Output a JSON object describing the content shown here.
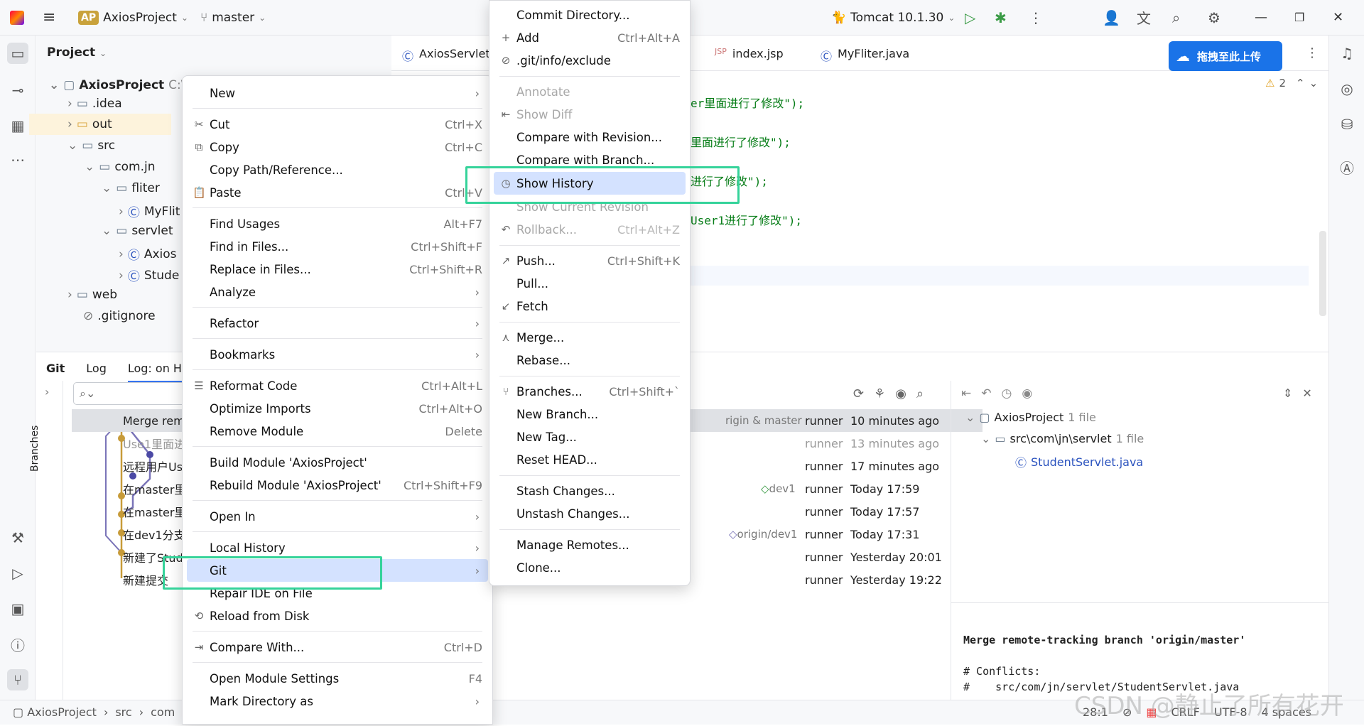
{
  "topbar": {
    "project_badge": "AP",
    "project_name": "AxiosProject",
    "branch": "master",
    "run_config": "Tomcat 10.1.30",
    "upload_button": "拖拽至此上传"
  },
  "project_panel": {
    "title": "Project",
    "tree": [
      {
        "label": "AxiosProject",
        "suffix": "C:\\"
      },
      {
        "label": ".idea"
      },
      {
        "label": "out"
      },
      {
        "label": "src"
      },
      {
        "label": "com.jn"
      },
      {
        "label": "fliter"
      },
      {
        "label": "MyFlit"
      },
      {
        "label": "servlet"
      },
      {
        "label": "Axios"
      },
      {
        "label": "Stude"
      },
      {
        "label": "web"
      },
      {
        "label": ".gitignore"
      }
    ]
  },
  "editor": {
    "tabs": [
      "AxiosServlet",
      "index.jsp",
      "MyFliter.java"
    ],
    "warnings": "2",
    "code_lines": [
      "er里面进行了修改\");",
      "里面进行了修改\");",
      "进行了修改\");",
      "User1进行了修改\");"
    ]
  },
  "git_panel": {
    "tabs": [
      "Git",
      "Log",
      "Log: on H"
    ],
    "branches_label": "Branches",
    "commits": [
      {
        "msg": "Merge remo",
        "tag": "rigin & master",
        "author": "runner",
        "time": "10 minutes ago"
      },
      {
        "msg": "Use1里面进",
        "tag": "",
        "author": "runner",
        "time": "13 minutes ago"
      },
      {
        "msg": "远程用户Us",
        "tag": "",
        "author": "runner",
        "time": "17 minutes ago"
      },
      {
        "msg": "在master里",
        "tag": "dev1",
        "author": "runner",
        "time": "Today 17:59"
      },
      {
        "msg": "在master里",
        "tag": "",
        "author": "runner",
        "time": "Today 17:57"
      },
      {
        "msg": "在dev1分支",
        "tag": "origin/dev1",
        "author": "runner",
        "time": "Today 17:31"
      },
      {
        "msg": "新建了Stud",
        "tag": "",
        "author": "runner",
        "time": "Yesterday 20:01"
      },
      {
        "msg": "新建提交",
        "tag": "",
        "author": "runner",
        "time": "Yesterday 19:22"
      }
    ],
    "changes": {
      "root": "AxiosProject",
      "root_count": "1 file",
      "dir": "src\\com\\jn\\servlet",
      "dir_count": "1 file",
      "file": "StudentServlet.java"
    },
    "commit_message": [
      "Merge remote-tracking branch 'origin/master'",
      "",
      "# Conflicts:",
      "#    src/com/jn/servlet/StudentServlet.java"
    ]
  },
  "statusbar": {
    "breadcrumb": [
      "AxiosProject",
      "src",
      "com"
    ],
    "position": "28:1",
    "line_sep": "CRLF",
    "encoding": "UTF-8",
    "indent": "4 spaces"
  },
  "context_menu": {
    "items": [
      {
        "label": "New",
        "shortcut": "",
        "submenu": true
      },
      {
        "label": "Cut",
        "shortcut": "Ctrl+X"
      },
      {
        "label": "Copy",
        "shortcut": "Ctrl+C"
      },
      {
        "label": "Copy Path/Reference...",
        "shortcut": ""
      },
      {
        "label": "Paste",
        "shortcut": "Ctrl+V"
      },
      {
        "label": "Find Usages",
        "shortcut": "Alt+F7"
      },
      {
        "label": "Find in Files...",
        "shortcut": "Ctrl+Shift+F"
      },
      {
        "label": "Replace in Files...",
        "shortcut": "Ctrl+Shift+R"
      },
      {
        "label": "Analyze",
        "shortcut": "",
        "submenu": true
      },
      {
        "label": "Refactor",
        "shortcut": "",
        "submenu": true
      },
      {
        "label": "Bookmarks",
        "shortcut": "",
        "submenu": true
      },
      {
        "label": "Reformat Code",
        "shortcut": "Ctrl+Alt+L"
      },
      {
        "label": "Optimize Imports",
        "shortcut": "Ctrl+Alt+O"
      },
      {
        "label": "Remove Module",
        "shortcut": "Delete"
      },
      {
        "label": "Build Module 'AxiosProject'",
        "shortcut": ""
      },
      {
        "label": "Rebuild Module 'AxiosProject'",
        "shortcut": "Ctrl+Shift+F9"
      },
      {
        "label": "Open In",
        "shortcut": "",
        "submenu": true
      },
      {
        "label": "Local History",
        "shortcut": "",
        "submenu": true
      },
      {
        "label": "Git",
        "shortcut": "",
        "submenu": true
      },
      {
        "label": "Repair IDE on File",
        "shortcut": ""
      },
      {
        "label": "Reload from Disk",
        "shortcut": ""
      },
      {
        "label": "Compare With...",
        "shortcut": "Ctrl+D"
      },
      {
        "label": "Open Module Settings",
        "shortcut": "F4"
      },
      {
        "label": "Mark Directory as",
        "shortcut": "",
        "submenu": true
      }
    ]
  },
  "git_submenu": {
    "items": [
      {
        "label": "Commit Directory...",
        "shortcut": ""
      },
      {
        "label": "Add",
        "shortcut": "Ctrl+Alt+A"
      },
      {
        "label": ".git/info/exclude",
        "shortcut": ""
      },
      {
        "label": "Annotate",
        "shortcut": "",
        "disabled": true
      },
      {
        "label": "Show Diff",
        "shortcut": "",
        "disabled": true
      },
      {
        "label": "Compare with Revision...",
        "shortcut": ""
      },
      {
        "label": "Compare with Branch...",
        "shortcut": ""
      },
      {
        "label": "Show History",
        "shortcut": ""
      },
      {
        "label": "Show Current Revision",
        "shortcut": "",
        "disabled": true
      },
      {
        "label": "Rollback...",
        "shortcut": "Ctrl+Alt+Z",
        "disabled": true
      },
      {
        "label": "Push...",
        "shortcut": "Ctrl+Shift+K"
      },
      {
        "label": "Pull...",
        "shortcut": ""
      },
      {
        "label": "Fetch",
        "shortcut": ""
      },
      {
        "label": "Merge...",
        "shortcut": ""
      },
      {
        "label": "Rebase...",
        "shortcut": ""
      },
      {
        "label": "Branches...",
        "shortcut": "Ctrl+Shift+`"
      },
      {
        "label": "New Branch...",
        "shortcut": ""
      },
      {
        "label": "New Tag...",
        "shortcut": ""
      },
      {
        "label": "Reset HEAD...",
        "shortcut": ""
      },
      {
        "label": "Stash Changes...",
        "shortcut": ""
      },
      {
        "label": "Unstash Changes...",
        "shortcut": ""
      },
      {
        "label": "Manage Remotes...",
        "shortcut": ""
      },
      {
        "label": "Clone...",
        "shortcut": ""
      }
    ]
  },
  "watermark": "CSDN @静止了所有花开",
  "colors": {
    "highlight": "#d4e2ff",
    "annotation": "#35d39a",
    "string": "#067d17",
    "link": "#2a52be"
  }
}
